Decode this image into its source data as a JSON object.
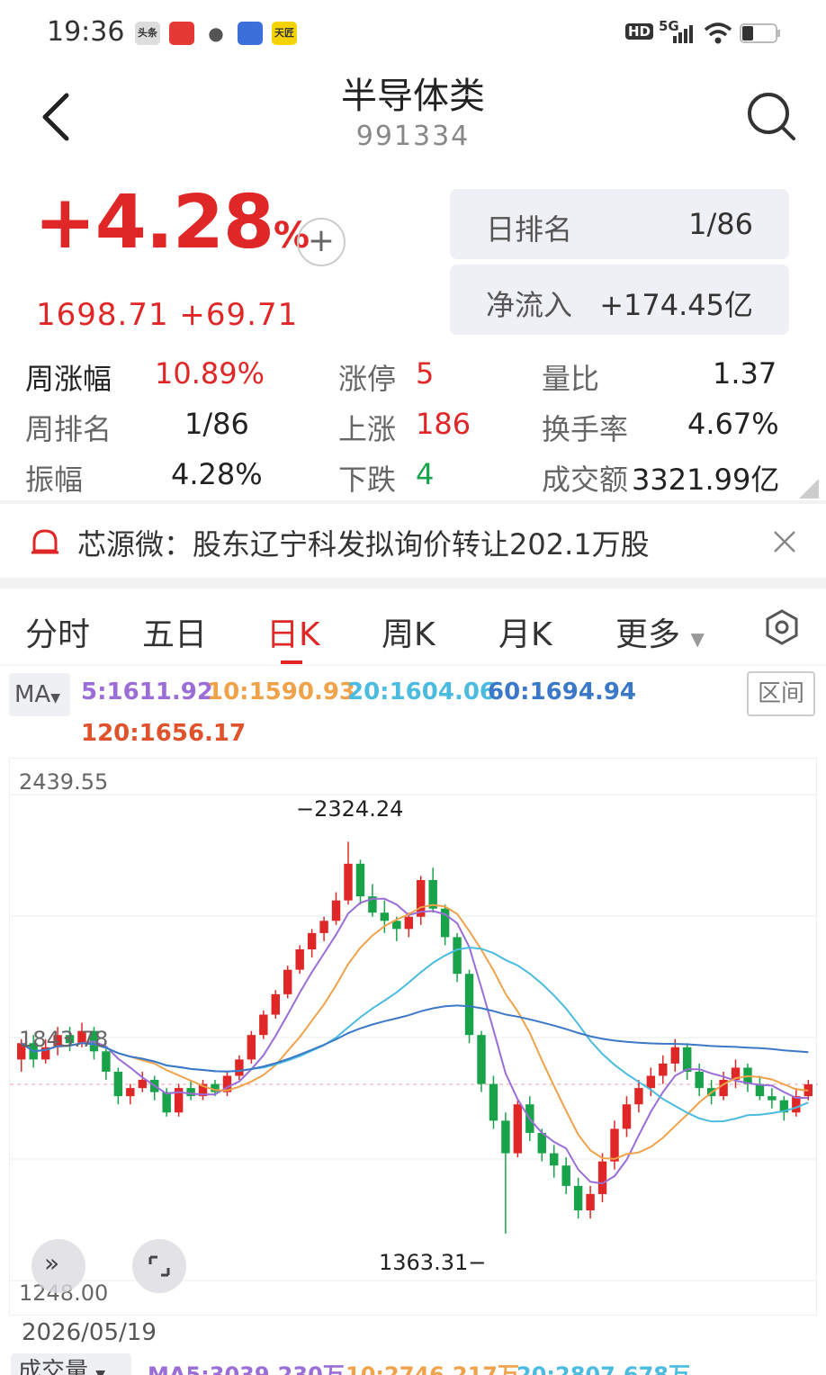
{
  "statusbar": {
    "time": "19:36",
    "network": "5G",
    "hd": "HD",
    "apps": [
      "头条",
      "",
      "",
      "",
      "天匠"
    ]
  },
  "header": {
    "title": "半导体类",
    "code": "991334"
  },
  "quote": {
    "change_pct": "+4.28",
    "pct_sign": "%",
    "price": "1698.71",
    "change": "+69.71",
    "add_label": "+"
  },
  "rank": {
    "day_rank_label": "日排名",
    "day_rank_value": "1/86",
    "net_inflow_label": "净流入",
    "net_inflow_value": "+174.45亿"
  },
  "stats": {
    "week_change_label": "周涨幅",
    "week_change_value": "10.89%",
    "week_rank_label": "周排名",
    "week_rank_value": "1/86",
    "amplitude_label": "振幅",
    "amplitude_value": "4.28%",
    "limit_up_label": "涨停",
    "limit_up_value": "5",
    "up_label": "上涨",
    "up_value": "186",
    "down_label": "下跌",
    "down_value": "4",
    "vol_ratio_label": "量比",
    "vol_ratio_value": "1.37",
    "turnover_label": "换手率",
    "turnover_value": "4.67%",
    "amount_label": "成交额",
    "amount_value": "3321.99亿"
  },
  "news": {
    "text": "芯源微：股东辽宁科发拟询价转让202.1万股"
  },
  "tabs": [
    "分时",
    "五日",
    "日K",
    "周K",
    "月K",
    "更多"
  ],
  "ma": {
    "button": "MA",
    "ma5": "5:1611.92",
    "ma10": "10:1590.93",
    "ma20": "20:1604.06",
    "ma60": "60:1694.94",
    "ma120": "120:1656.17",
    "range_button": "区间",
    "colors": {
      "ma5": "#9a6dd7",
      "ma10": "#f0a24a",
      "ma20": "#4bbce0",
      "ma60": "#3b78c7",
      "ma120": "#e0522b",
      "up": "#e02727",
      "down": "#18a34a"
    }
  },
  "chart_data": {
    "type": "candlestick",
    "y_top_label": "2439.55",
    "y_mid_label": "1843.78",
    "y_bottom_label": "1248.00",
    "high_label": "2324.24",
    "low_label": "1363.31",
    "ylim": [
      1248.0,
      2439.55
    ],
    "date": "2026/05/19",
    "candles": [
      [
        1790,
        1830,
        1760,
        1840
      ],
      [
        1830,
        1790,
        1770,
        1850
      ],
      [
        1790,
        1820,
        1780,
        1840
      ],
      [
        1820,
        1850,
        1800,
        1870
      ],
      [
        1850,
        1830,
        1810,
        1870
      ],
      [
        1830,
        1860,
        1820,
        1880
      ],
      [
        1860,
        1810,
        1790,
        1870
      ],
      [
        1810,
        1760,
        1740,
        1820
      ],
      [
        1760,
        1700,
        1680,
        1770
      ],
      [
        1700,
        1720,
        1680,
        1730
      ],
      [
        1720,
        1740,
        1710,
        1760
      ],
      [
        1740,
        1710,
        1690,
        1750
      ],
      [
        1710,
        1660,
        1650,
        1720
      ],
      [
        1660,
        1720,
        1650,
        1730
      ],
      [
        1720,
        1700,
        1690,
        1740
      ],
      [
        1700,
        1730,
        1690,
        1740
      ],
      [
        1730,
        1710,
        1700,
        1740
      ],
      [
        1710,
        1750,
        1700,
        1760
      ],
      [
        1750,
        1790,
        1740,
        1800
      ],
      [
        1790,
        1850,
        1780,
        1860
      ],
      [
        1850,
        1900,
        1840,
        1910
      ],
      [
        1900,
        1950,
        1890,
        1960
      ],
      [
        1950,
        2010,
        1940,
        2020
      ],
      [
        2010,
        2060,
        2000,
        2070
      ],
      [
        2060,
        2100,
        2040,
        2110
      ],
      [
        2100,
        2130,
        2080,
        2140
      ],
      [
        2130,
        2180,
        2120,
        2200
      ],
      [
        2180,
        2270,
        2170,
        2324
      ],
      [
        2270,
        2190,
        2170,
        2280
      ],
      [
        2190,
        2150,
        2140,
        2220
      ],
      [
        2150,
        2130,
        2100,
        2180
      ],
      [
        2130,
        2110,
        2080,
        2140
      ],
      [
        2110,
        2140,
        2090,
        2150
      ],
      [
        2140,
        2230,
        2120,
        2240
      ],
      [
        2230,
        2160,
        2150,
        2260
      ],
      [
        2160,
        2090,
        2070,
        2170
      ],
      [
        2090,
        2000,
        1980,
        2100
      ],
      [
        2000,
        1850,
        1830,
        2010
      ],
      [
        1850,
        1730,
        1710,
        1860
      ],
      [
        1730,
        1640,
        1620,
        1750
      ],
      [
        1640,
        1560,
        1363,
        1660
      ],
      [
        1560,
        1680,
        1550,
        1690
      ],
      [
        1680,
        1610,
        1590,
        1700
      ],
      [
        1610,
        1560,
        1540,
        1620
      ],
      [
        1560,
        1530,
        1500,
        1580
      ],
      [
        1530,
        1480,
        1460,
        1550
      ],
      [
        1480,
        1420,
        1400,
        1500
      ],
      [
        1420,
        1460,
        1400,
        1480
      ],
      [
        1460,
        1540,
        1440,
        1560
      ],
      [
        1540,
        1620,
        1520,
        1640
      ],
      [
        1620,
        1680,
        1600,
        1700
      ],
      [
        1680,
        1720,
        1660,
        1740
      ],
      [
        1720,
        1750,
        1700,
        1770
      ],
      [
        1750,
        1780,
        1730,
        1800
      ],
      [
        1780,
        1820,
        1760,
        1840
      ],
      [
        1820,
        1760,
        1740,
        1830
      ],
      [
        1760,
        1720,
        1700,
        1780
      ],
      [
        1720,
        1700,
        1680,
        1740
      ],
      [
        1700,
        1740,
        1690,
        1760
      ],
      [
        1740,
        1770,
        1720,
        1790
      ],
      [
        1770,
        1730,
        1710,
        1780
      ],
      [
        1730,
        1700,
        1690,
        1750
      ],
      [
        1700,
        1690,
        1670,
        1720
      ],
      [
        1690,
        1660,
        1640,
        1700
      ],
      [
        1660,
        1700,
        1650,
        1720
      ],
      [
        1700,
        1729,
        1690,
        1740
      ]
    ]
  },
  "volume": {
    "button": "成交量",
    "ma5": "MA5:3039.230万",
    "ma10": "10:2746.217万",
    "ma20": "20:2807.678万"
  }
}
